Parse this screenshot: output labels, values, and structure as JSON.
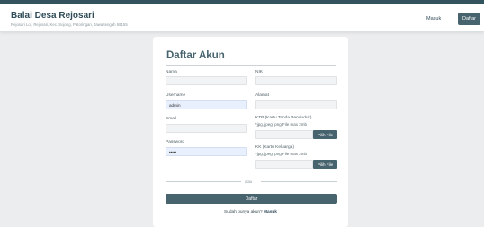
{
  "header": {
    "title": "Balai Desa Rejosari",
    "subtitle": "Rejosari Lor, Rejosari, Kec. Sojong, Patoringan, Jawa tengah 59155",
    "nav_login": "Masuk",
    "nav_register": "Daftar"
  },
  "form": {
    "title": "Daftar Akun",
    "fields": {
      "nama": {
        "label": "Nama",
        "value": ""
      },
      "nik": {
        "label": "NIK",
        "value": ""
      },
      "username": {
        "label": "Username",
        "value": "admin"
      },
      "alamat": {
        "label": "Alamat",
        "value": ""
      },
      "email": {
        "label": "Email",
        "value": ""
      },
      "ktp": {
        "label": "KTP (Kartu Tanda Penduduk)",
        "hint": "*jpg, jpeg, png File max 2mb",
        "button": "Pilih File"
      },
      "password": {
        "label": "Password",
        "value": "•••••"
      },
      "kk": {
        "label": "KK (Kartu Keluarga)",
        "hint": "*jpg, jpeg, png File max 2mb",
        "button": "Pilih File"
      }
    },
    "divider_text": "atau",
    "submit_label": "Daftar",
    "footer_text": "Sudah punya akun?",
    "footer_link": "Masuk"
  }
}
